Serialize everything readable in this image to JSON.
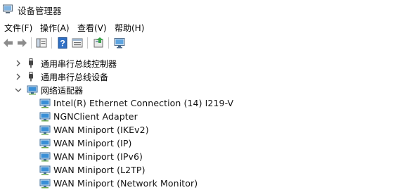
{
  "window": {
    "title": "设备管理器"
  },
  "menu": {
    "file": "文件(F)",
    "action": "操作(A)",
    "view": "查看(V)",
    "help": "帮助(H)"
  },
  "tree": {
    "usb_controllers": "通用串行总线控制器",
    "usb_devices": "通用串行总线设备",
    "network_adapters": "网络适配器",
    "adapters": [
      "Intel(R) Ethernet Connection (14) I219-V",
      "NGNClient Adapter",
      "WAN Miniport (IKEv2)",
      "WAN Miniport (IP)",
      "WAN Miniport (IPv6)",
      "WAN Miniport (L2TP)",
      "WAN Miniport (Network Monitor)"
    ]
  },
  "colors": {
    "monitor_blue": "#3a8fd6",
    "toolbar_help_blue": "#2f6fc4"
  }
}
